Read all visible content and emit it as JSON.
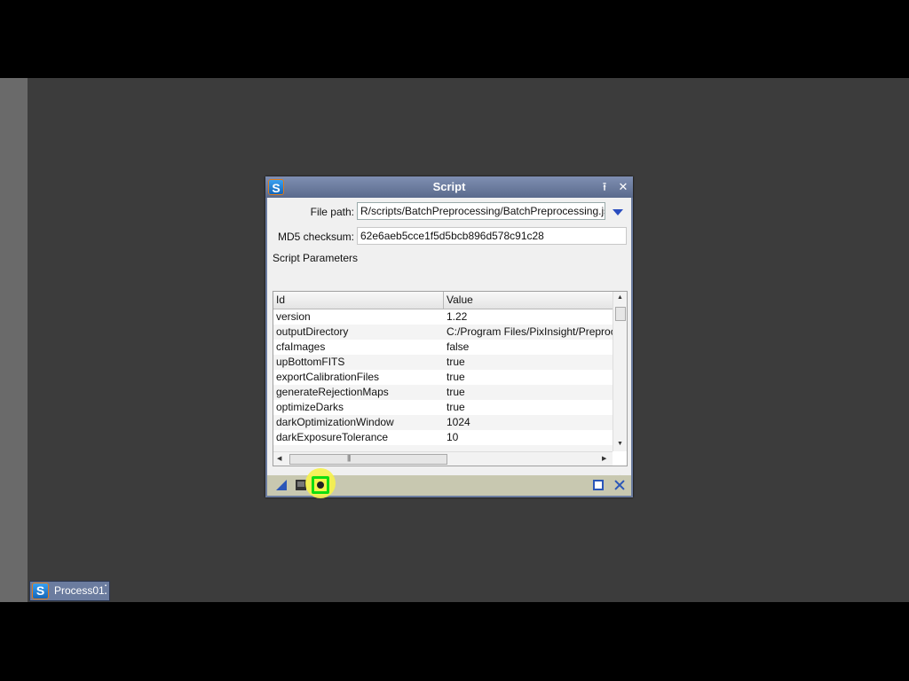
{
  "window": {
    "title": "Script",
    "shade_icon": "shade-icon",
    "close_icon": "close-icon"
  },
  "file_path": {
    "label": "File path:",
    "value": "R/scripts/BatchPreprocessing/BatchPreprocessing.js"
  },
  "md5": {
    "label": "MD5 checksum:",
    "value": "62e6aeb5cce1f5d5bcb896d578c91c28"
  },
  "parameters": {
    "section_title": "Script Parameters",
    "columns": [
      "Id",
      "Value"
    ],
    "rows": [
      {
        "id": "version",
        "value": "1.22"
      },
      {
        "id": "outputDirectory",
        "value": "C:/Program Files/PixInsight/Preproc"
      },
      {
        "id": "cfaImages",
        "value": "false"
      },
      {
        "id": "upBottomFITS",
        "value": "true"
      },
      {
        "id": "exportCalibrationFiles",
        "value": "true"
      },
      {
        "id": "generateRejectionMaps",
        "value": "true"
      },
      {
        "id": "optimizeDarks",
        "value": "true"
      },
      {
        "id": "darkOptimizationWindow",
        "value": "1024"
      },
      {
        "id": "darkExposureTolerance",
        "value": "10"
      }
    ]
  },
  "toolbar": {
    "add_icon": "add-icon",
    "remove_icon": "remove-icon",
    "edit_icon": "edit-icon"
  },
  "bottom_bar": {
    "icons": [
      "new-instance-icon",
      "apply-global-icon",
      "execute-icon",
      "documentation-icon",
      "reset-icon"
    ]
  },
  "process_icon": {
    "label": "Process01"
  }
}
